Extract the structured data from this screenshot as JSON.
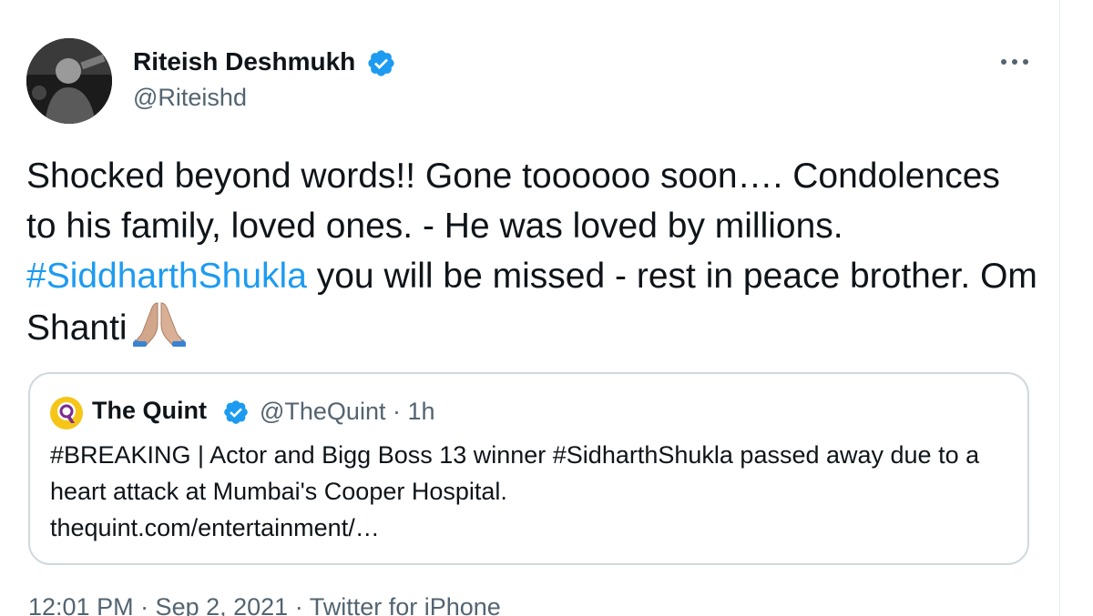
{
  "tweet": {
    "author": {
      "name": "Riteish Deshmukh",
      "handle": "@Riteishd",
      "verified": true
    },
    "text": {
      "before_hashtag": "Shocked beyond words!! Gone toooooo soon…. Condolences to his family, loved ones. - He was loved by millions. ",
      "hashtag": "#SiddharthShukla",
      "after_hashtag": " you will be missed - rest in peace brother. Om Shanti",
      "emoji_icon": "folded-hands-icon"
    },
    "quoted": {
      "name": "The Quint",
      "handle": "@TheQuint",
      "separator": " · ",
      "time": "1h",
      "verified": true,
      "text": "#BREAKING | Actor and Bigg Boss 13 winner #SidharthShukla passed away due to a heart attack at Mumbai's Cooper Hospital.",
      "link": "thequint.com/entertainment/…"
    },
    "footer": "12:01 PM · Sep 2, 2021 · Twitter for iPhone"
  },
  "colors": {
    "hashtag": "#1d9bf0",
    "verified": "#1d9bf0",
    "muted": "#536471",
    "border": "#cfd9de"
  }
}
